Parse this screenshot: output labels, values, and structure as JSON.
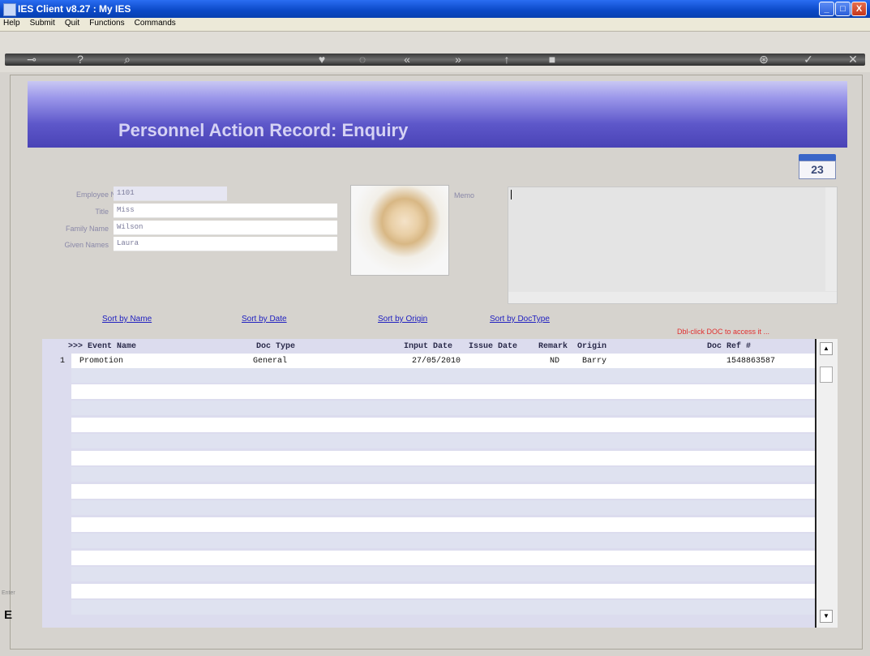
{
  "window": {
    "title": "IES Client v8.27 : My IES",
    "minimize": "_",
    "maximize": "□",
    "close": "X"
  },
  "menu": [
    "Help",
    "Submit",
    "Quit",
    "Functions",
    "Commands"
  ],
  "toolbar": {
    "icons": [
      "key-icon",
      "help-icon",
      "search-icon",
      "heart-icon",
      "circle-icon",
      "back-icon",
      "forward-icon",
      "info-icon",
      "stop-icon",
      "settings-icon",
      "ok-icon",
      "close-icon"
    ],
    "glyphs": [
      "⊸",
      "?",
      "⌕",
      "♥",
      "◌",
      "«",
      "»",
      "↑",
      "■",
      "⊛",
      "✓",
      "✕"
    ]
  },
  "header": {
    "title": "Personnel Action Record: Enquiry"
  },
  "calendar": {
    "day": "23"
  },
  "form": {
    "employee_no": {
      "label": "Employee No",
      "value": "1101"
    },
    "title": {
      "label": "Title",
      "value": "Miss"
    },
    "family_name": {
      "label": "Family Name",
      "value": "Wilson"
    },
    "given_names": {
      "label": "Given Names",
      "value": "Laura"
    },
    "memo_label": "Memo"
  },
  "sort_links": [
    "Sort by Name",
    "Sort by Date",
    "Sort by Origin",
    "Sort by DocType"
  ],
  "hint": "Dbl-click DOC to access it ...",
  "table": {
    "headers": [
      ">>> Event Name",
      "Doc Type",
      "Input Date",
      "Issue Date",
      "Remark",
      "Origin",
      "Doc Ref #"
    ],
    "rows": [
      {
        "num": "1",
        "event": "Promotion",
        "doc_type": "General",
        "input_date": "27/05/2010",
        "issue_date": "",
        "remark": "ND",
        "origin": "Barry",
        "doc_ref": "1548863587"
      }
    ]
  },
  "left_edge": {
    "label": "Enter",
    "letter": "E"
  }
}
